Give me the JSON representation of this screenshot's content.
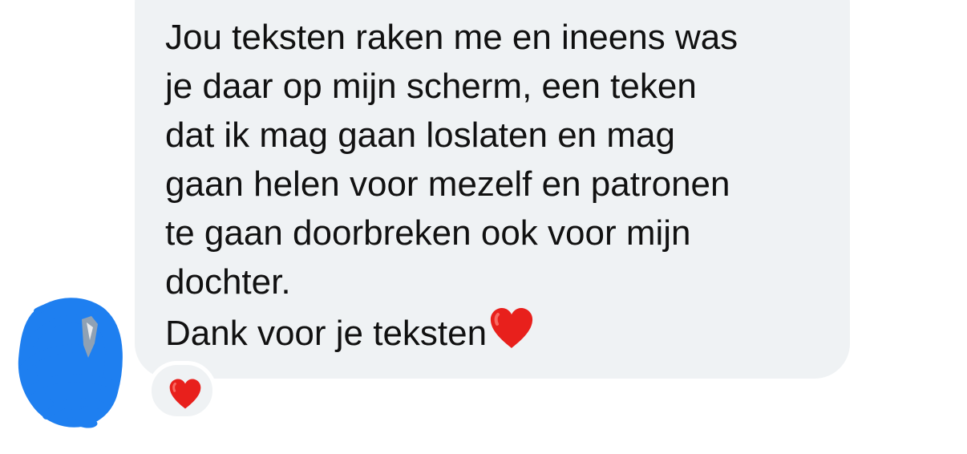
{
  "message": {
    "lines": [
      "Jou teksten raken me en ineens was",
      "je daar op mijn scherm, een teken",
      "dat ik mag gaan loslaten en mag",
      "gaan helen voor mezelf en patronen",
      "te gaan doorbreken ook voor mijn",
      "dochter.",
      "Dank voor je teksten"
    ],
    "trailing_emoji_icon": "red-heart-icon"
  },
  "reaction": {
    "icon": "red-heart-icon"
  },
  "avatar": {
    "state": "scribbled-out",
    "scribble_color": "#1e7ff0"
  },
  "colors": {
    "bubble": "#eff2f4",
    "text": "#111111",
    "heart": "#e8201c",
    "background": "#ffffff"
  }
}
